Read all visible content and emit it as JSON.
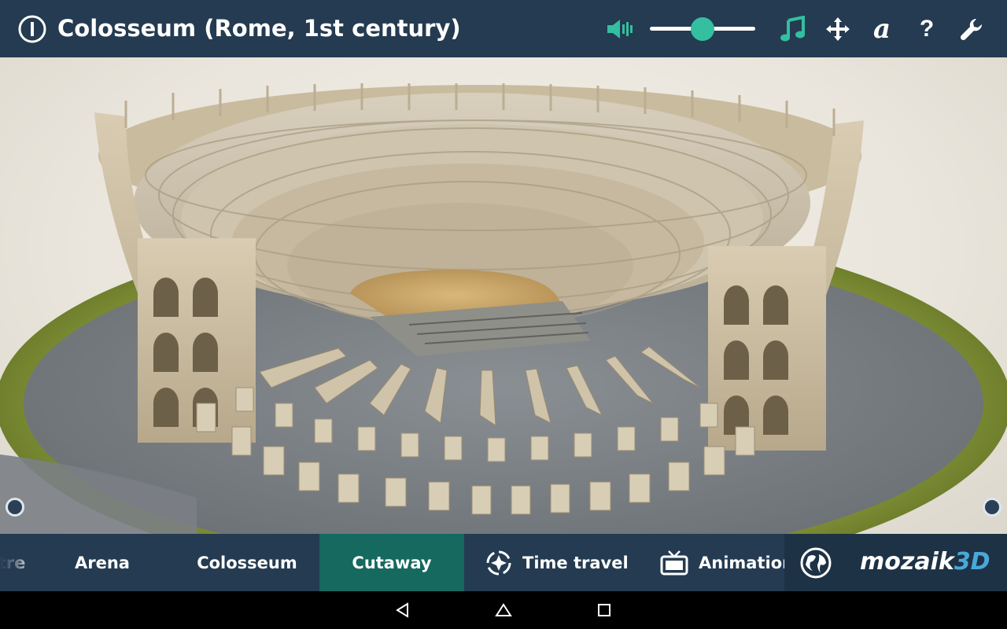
{
  "app": {
    "title": "Colosseum (Rome, 1st century)"
  },
  "toolbar": {
    "volume_icon": "speaker-icon",
    "volume_level": 0.5,
    "music_icon": "music-note-icon",
    "move_icon": "move-arrows-icon",
    "label_glyph": "a",
    "help_glyph": "?",
    "settings_icon": "wrench-icon"
  },
  "colors": {
    "bar": "#243b51",
    "accent": "#33bfa0",
    "active_tab": "#15695f",
    "brand_3d": "#4aa8d8"
  },
  "nav": {
    "tabs": [
      {
        "label": "tre",
        "active": false
      },
      {
        "label": "Arena",
        "active": false
      },
      {
        "label": "Colosseum",
        "active": false
      },
      {
        "label": "Cutaway",
        "active": true
      },
      {
        "label": "Time travel",
        "active": false,
        "icon": "time-travel-icon"
      },
      {
        "label": "Animation",
        "active": false,
        "icon": "tv-icon"
      }
    ]
  },
  "brand": {
    "logo_main": "mozaik",
    "logo_accent": "3D",
    "globe_icon": "globe-icon"
  },
  "system": {
    "back_icon": "back-triangle-icon",
    "home_icon": "home-circle-icon",
    "recents_icon": "recents-square-icon"
  }
}
